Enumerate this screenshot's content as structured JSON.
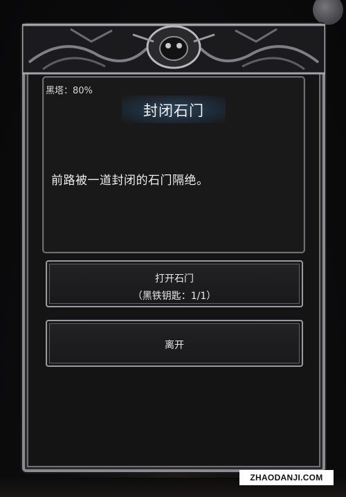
{
  "header": {
    "tower_progress": "黑塔：80%"
  },
  "event": {
    "title": "封闭石门",
    "description": "前路被一道封闭的石门隔绝。"
  },
  "options": {
    "open_line1": "打开石门",
    "open_line2": "（黑铁钥匙：1/1）",
    "leave": "离开"
  },
  "watermark": "ZHAODANJI.COM",
  "colors": {
    "frame": "#8b8b90",
    "title_glow": "#2c4156",
    "background": "#0c0c0d"
  }
}
